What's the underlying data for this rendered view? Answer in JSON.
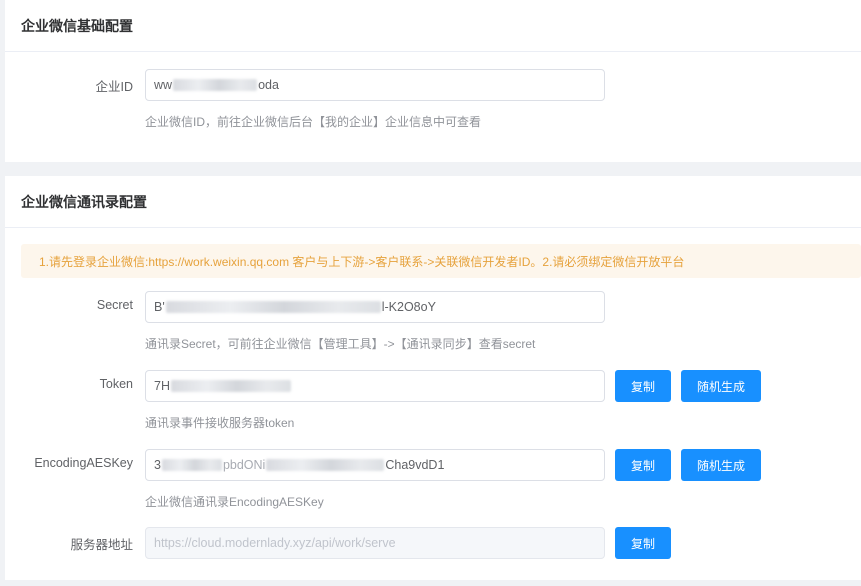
{
  "basic": {
    "title": "企业微信基础配置",
    "corp_id": {
      "label": "企业ID",
      "value_start": "ww",
      "value_end": "oda",
      "hint": "企业微信ID，前往企业微信后台【我的企业】企业信息中可查看"
    }
  },
  "contacts": {
    "title": "企业微信通讯录配置",
    "notice": "1.请先登录企业微信:https://work.weixin.qq.com 客户与上下游->客户联系->关联微信开发者ID。2.请必须绑定微信开放平台",
    "secret": {
      "label": "Secret",
      "value_start": "B'",
      "value_end": "l-K2O8oY",
      "hint": "通讯录Secret，可前往企业微信【管理工具】->【通讯录同步】查看secret"
    },
    "token": {
      "label": "Token",
      "value_start": "7H",
      "hint": "通讯录事件接收服务器token",
      "copy_label": "复制",
      "generate_label": "随机生成"
    },
    "aeskey": {
      "label": "EncodingAESKey",
      "value_start": "3",
      "value_mid": "pbdONi",
      "value_end": "Cha9vdD1",
      "hint": "企业微信通讯录EncodingAESKey",
      "copy_label": "复制",
      "generate_label": "随机生成"
    },
    "server": {
      "label": "服务器地址",
      "value": "https://cloud.modernlady.xyz/api/work/serve",
      "copy_label": "复制"
    }
  }
}
